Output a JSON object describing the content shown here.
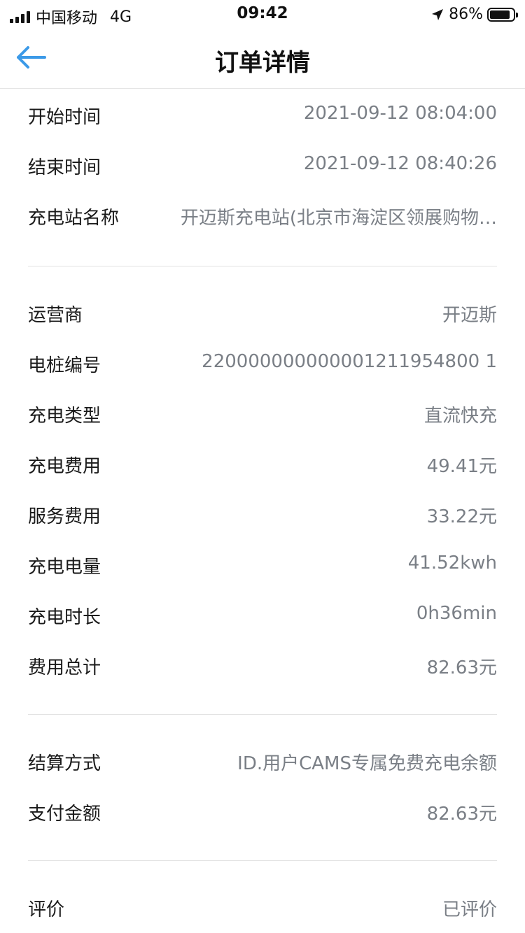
{
  "status_bar": {
    "carrier": "中国移动",
    "network": "4G",
    "time": "09:42",
    "battery": "86%",
    "battery_level": 0.86
  },
  "nav": {
    "title": "订单详情",
    "back_icon": "arrow-left-icon"
  },
  "section1": [
    {
      "label": "开始时间",
      "value": "2021-09-12 08:04:00"
    },
    {
      "label": "结束时间",
      "value": "2021-09-12 08:40:26"
    },
    {
      "label": "充电站名称",
      "value": "开迈斯充电站(北京市海淀区领展购物…"
    }
  ],
  "section2": [
    {
      "label": "运营商",
      "value": "开迈斯"
    },
    {
      "label": "电桩编号",
      "value": "220000000000001211954800 1"
    },
    {
      "label": "充电类型",
      "value": "直流快充"
    },
    {
      "label": "充电费用",
      "value": "49.41元"
    },
    {
      "label": "服务费用",
      "value": "33.22元"
    },
    {
      "label": "充电电量",
      "value": "41.52kwh"
    },
    {
      "label": "充电时长",
      "value": "0h36min"
    },
    {
      "label": "费用总计",
      "value": "82.63元"
    }
  ],
  "section3": [
    {
      "label": "结算方式",
      "value": "ID.用户CAMS专属免费充电余额"
    },
    {
      "label": "支付金额",
      "value": "82.63元"
    }
  ],
  "section4": [
    {
      "label": "评价",
      "value": "已评价"
    }
  ],
  "colors": {
    "accent": "#3c9ae8",
    "label": "#1a1a1a",
    "value": "#7a7f86",
    "divider": "#e2e2e2"
  }
}
